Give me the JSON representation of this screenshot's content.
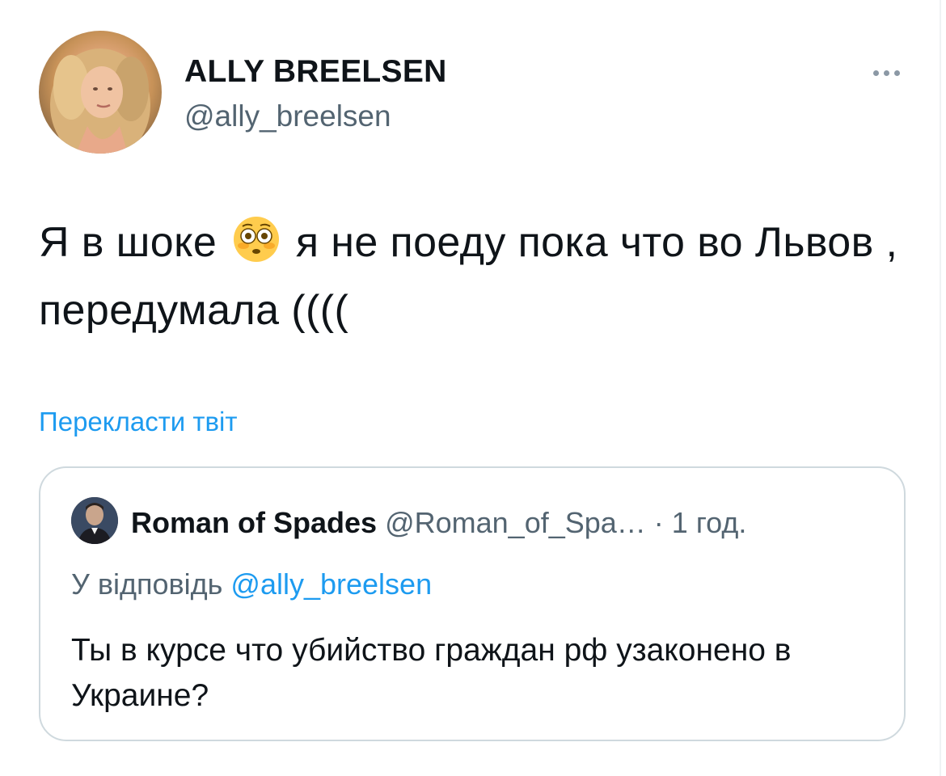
{
  "tweet": {
    "author": {
      "display_name": "ALLY BREELSEN",
      "handle": "@ally_breelsen",
      "avatar": "profile-photo"
    },
    "more_icon": "more-horizontal-icon",
    "text_before_emoji": "Я в шоке ",
    "emoji": "flushed-face-emoji",
    "text_after_emoji": " я не поеду пока что во Львов , передумала ((((",
    "translate_label": "Перекласти твіт"
  },
  "quote": {
    "avatar": "profile-photo",
    "display_name": "Roman of Spades",
    "handle": "@Roman_of_Spa…",
    "separator": " · ",
    "time": "1 год.",
    "reply_prefix": "У відповідь ",
    "reply_mention": "@ally_breelsen",
    "text": "Ты в курсе что убийство граждан рф узаконено в Украине?"
  },
  "colors": {
    "text_primary": "#0f1419",
    "text_secondary": "#536471",
    "link": "#1d9bf0",
    "border": "#cfd9de"
  }
}
